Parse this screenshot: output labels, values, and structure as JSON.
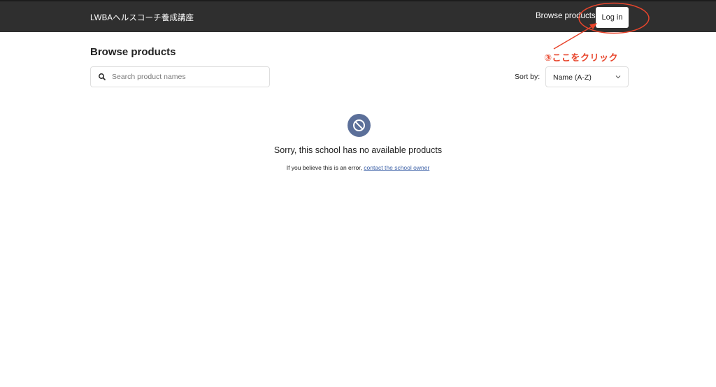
{
  "header": {
    "school_name": "LWBAヘルスコーチ養成講座",
    "nav_browse": "Browse products",
    "login_label": "Log in"
  },
  "main": {
    "title": "Browse products",
    "search": {
      "placeholder": "Search product names",
      "value": ""
    },
    "sort": {
      "label": "Sort by:",
      "selected": "Name (A-Z)"
    },
    "empty_state": {
      "icon": "no-products-icon",
      "title": "Sorry, this school has no available products",
      "subtitle": "If you believe this is an error, ",
      "link_text": "contact the school owner"
    }
  },
  "annotation": {
    "text": "③ここをクリック",
    "color": "#e8452c"
  },
  "colors": {
    "header_bg": "#2f2f2f",
    "icon_bg": "#5b6f99",
    "link": "#3f63a8"
  }
}
